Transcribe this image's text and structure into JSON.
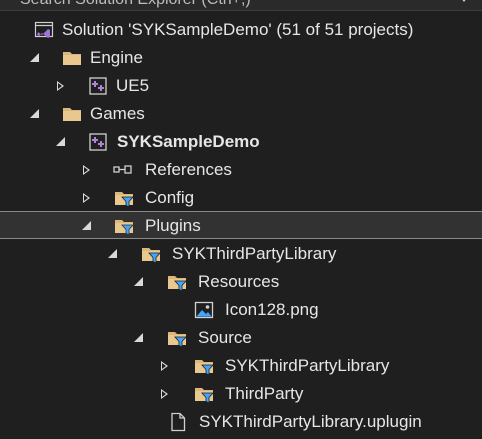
{
  "search": {
    "placeholder": "Search Solution Explorer (Ctrl+;)"
  },
  "colors": {
    "background": "#1f1f1f",
    "folder": "#dcb67a",
    "filter_funnel": "#3fa6ff",
    "project_icon": "#b180d7",
    "vs_logo": "#a372d6"
  },
  "tree": {
    "solution": {
      "label": "Solution 'SYKSampleDemo' (51 of 51 projects)",
      "icon": "visual-studio-solution-icon"
    },
    "engine": {
      "label": "Engine",
      "expanded": true,
      "icon": "folder-icon"
    },
    "ue5": {
      "label": "UE5",
      "expanded": false,
      "icon": "cpp-project-icon"
    },
    "games": {
      "label": "Games",
      "expanded": true,
      "icon": "folder-icon"
    },
    "syksampledemo": {
      "label": "SYKSampleDemo",
      "expanded": true,
      "icon": "cpp-project-icon"
    },
    "references": {
      "label": "References",
      "expanded": false,
      "icon": "references-icon"
    },
    "config": {
      "label": "Config",
      "expanded": false,
      "icon": "filter-folder-icon"
    },
    "plugins": {
      "label": "Plugins",
      "expanded": true,
      "selected": true,
      "icon": "filter-folder-icon"
    },
    "sykthirdpartylibrary": {
      "label": "SYKThirdPartyLibrary",
      "expanded": true,
      "icon": "filter-folder-icon"
    },
    "resources": {
      "label": "Resources",
      "expanded": true,
      "icon": "filter-folder-icon"
    },
    "icon128": {
      "label": "Icon128.png",
      "icon": "image-file-icon"
    },
    "source": {
      "label": "Source",
      "expanded": true,
      "icon": "filter-folder-icon"
    },
    "source_syktpl": {
      "label": "SYKThirdPartyLibrary",
      "expanded": false,
      "icon": "filter-folder-icon"
    },
    "thirdparty": {
      "label": "ThirdParty",
      "expanded": false,
      "icon": "filter-folder-icon"
    },
    "uplugin": {
      "label": "SYKThirdPartyLibrary.uplugin",
      "icon": "file-icon"
    }
  }
}
